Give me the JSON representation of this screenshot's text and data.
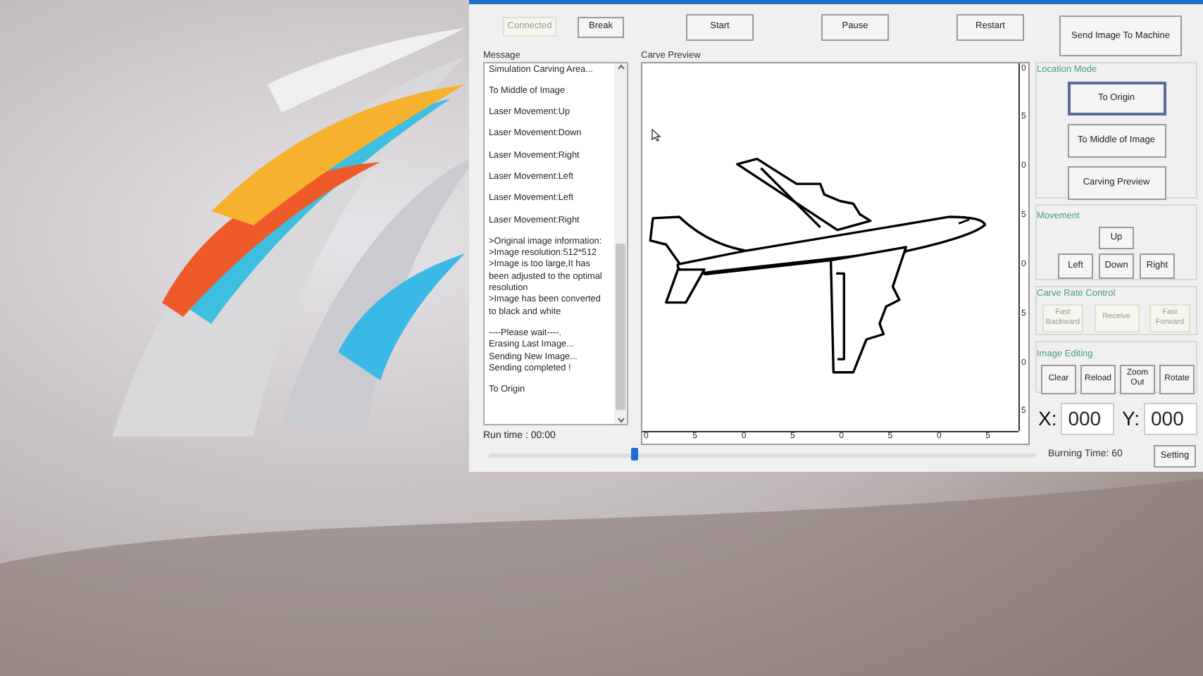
{
  "toolbar": [
    {
      "label": "Connected",
      "kind": "small",
      "disabled": true
    },
    {
      "label": "Break",
      "kind": "small",
      "disabled": false
    },
    {
      "label": "Start",
      "kind": "large",
      "disabled": false
    },
    {
      "label": "Pause",
      "kind": "large",
      "disabled": false
    },
    {
      "label": "Restart",
      "kind": "large",
      "disabled": false
    }
  ],
  "messages": {
    "title": "Message",
    "entries": [
      {
        "lines": [
          "Simulation Carving Area..."
        ]
      },
      {
        "lines": [
          "To Middle of Image"
        ]
      },
      {
        "lines": [
          "Laser Movement:Up"
        ]
      },
      {
        "lines": [
          "Laser Movement:Down"
        ]
      },
      {
        "lines": [
          "Laser Movement:Right"
        ]
      },
      {
        "lines": [
          "Laser Movement:Left"
        ]
      },
      {
        "lines": [
          "Laser Movement:Left"
        ]
      },
      {
        "lines": [
          "Laser Movement:Right"
        ]
      },
      {
        "lines": [
          ">Original image information:",
          ">Image resolution:512*512",
          ">Image is too large,It has been adjusted to the optimal resolution",
          ">Image has been converted to black and white"
        ]
      },
      {
        "lines": [
          "----Please wait----.",
          "Erasing Last Image...",
          "Sending New Image...",
          "Sending completed !"
        ]
      },
      {
        "lines": [
          "To Origin"
        ]
      }
    ],
    "run_time": "Run time :  00:00"
  },
  "preview": {
    "title": "Carve Preview",
    "x_axis_labels": [
      "0",
      "5",
      "0",
      "5",
      "0",
      "5",
      "0",
      "5"
    ],
    "y_axis_labels": [
      "0",
      "5",
      "0",
      "5",
      "0",
      "5",
      "0",
      "5"
    ]
  },
  "send_button": "Send Image To Machine",
  "location_mode": {
    "title": "Location Mode",
    "buttons": [
      {
        "label": "To Origin",
        "selected": true
      },
      {
        "label": "To Middle of Image",
        "selected": false
      },
      {
        "label": "Carving Preview",
        "selected": false
      }
    ]
  },
  "movement": {
    "title": "Movement",
    "buttons": [
      "Up",
      "Left",
      "Down",
      "Right"
    ]
  },
  "carve_rate": {
    "title": "Carve Rate Control",
    "buttons": [
      {
        "label": "Fast Backward",
        "disabled": true
      },
      {
        "label": "Receive",
        "disabled": true
      },
      {
        "label": "Fast Forward",
        "disabled": true
      }
    ]
  },
  "image_editing": {
    "title": "Image Editing",
    "buttons": [
      "Clear",
      "Reload",
      "Zoom Out",
      "Rotate"
    ]
  },
  "coordinates": [
    {
      "label": "X:",
      "value": "000"
    },
    {
      "label": "Y:",
      "value": "000"
    }
  ],
  "burning": {
    "level": 0.26,
    "label": "Burning Time: 60",
    "button": "Setting"
  }
}
